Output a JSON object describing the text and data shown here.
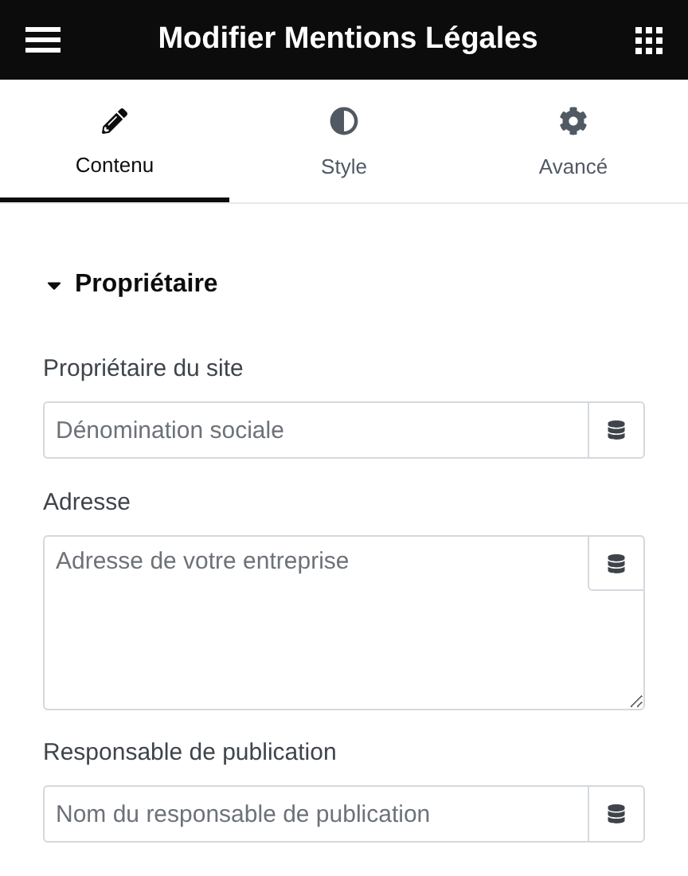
{
  "header": {
    "title": "Modifier Mentions Légales"
  },
  "tabs": [
    {
      "label": "Contenu",
      "selected": true
    },
    {
      "label": "Style",
      "selected": false
    },
    {
      "label": "Avancé",
      "selected": false
    }
  ],
  "section": {
    "title": "Propriétaire",
    "expanded": true,
    "fields": [
      {
        "kind": "input",
        "label": "Propriétaire du site",
        "placeholder": "Dénomination sociale"
      },
      {
        "kind": "textarea",
        "label": "Adresse",
        "placeholder": "Adresse de votre entreprise"
      },
      {
        "kind": "input",
        "label": "Responsable de publication",
        "placeholder": "Nom du responsable de publication"
      }
    ]
  }
}
